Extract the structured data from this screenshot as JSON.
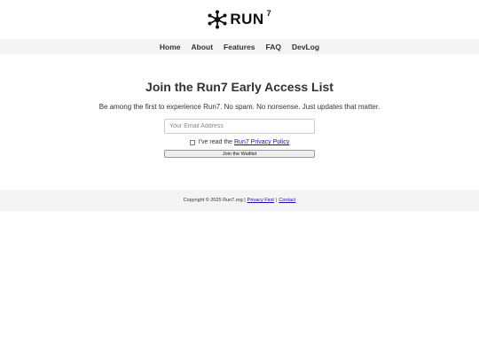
{
  "brand": {
    "name": "RUN",
    "sup": "7",
    "icon": "hub-nodes-icon"
  },
  "nav": {
    "items": [
      "Home",
      "About",
      "Features",
      "FAQ",
      "DevLog"
    ]
  },
  "main": {
    "title": "Join the Run7 Early Access List",
    "subtitle": "Be among the first to experience Run7. No spam. No nonsense. Just updates that matter.",
    "email_placeholder": "Your Email Address",
    "consent_prefix": "I've read the ",
    "consent_link": "Run7 Privacy Policy",
    "submit_label": "Join the Waitlist"
  },
  "footer": {
    "copyright": "Copyright © 2025 Run7.org |",
    "privacy_link": "Privacy First",
    "separator": "|",
    "contact_link": "Contact"
  }
}
